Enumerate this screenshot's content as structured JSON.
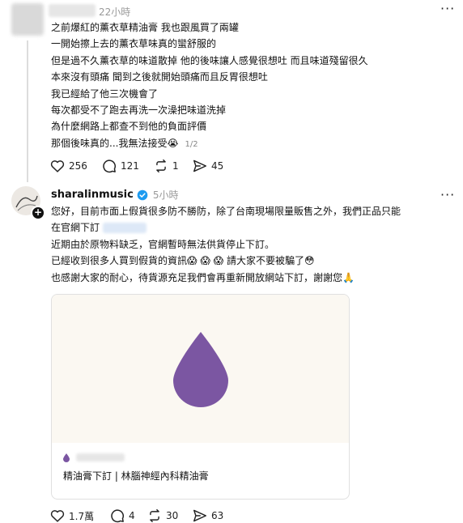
{
  "post1": {
    "time": "22小時",
    "lines": [
      "之前爆紅的薰衣草精油膏 我也跟風買了兩罐",
      "一開始擦上去的薰衣草味真的蠻舒服的",
      "但是過不久薰衣草的味道散掉 他的後味讓人感覺很想吐 而且味道殘留很久",
      "本來沒有頭痛 聞到之後就開始頭痛而且反胃很想吐",
      "我已經給了他三次機會了",
      "每次都受不了跑去再洗一次澡把味道洗掉",
      "為什麼網路上都查不到他的負面評價",
      "那個後味真的...我無法接受😭"
    ],
    "page_indicator": "1/2",
    "stats": {
      "likes": "256",
      "comments": "121",
      "reposts": "1",
      "shares": "45"
    }
  },
  "post2": {
    "username": "sharalinmusic",
    "time": "5小時",
    "line1": "您好，目前市面上假貨很多防不勝防，除了台南現場限量販售之外，我們正品只能",
    "line2": "在官網下訂",
    "line3": "近期由於原物料缺乏，官網暫時無法供貨停止下訂。",
    "line4": "已經收到很多人買到假貨的資訊😱 😱 😱  請大家不要被騙了😳",
    "line5": "也感謝大家的耐心，待貨源充足我們會再重新開放網站下訂，謝謝您🙏",
    "card_caption": "精油膏下訂 | 林腦神經內科精油膏",
    "stats": {
      "likes": "1.7萬",
      "comments": "4",
      "reposts": "30",
      "shares": "63"
    }
  },
  "colors": {
    "drop": "#7b56a2",
    "verified": "#1d9bf0",
    "card_bg": "#fbf8f2"
  }
}
